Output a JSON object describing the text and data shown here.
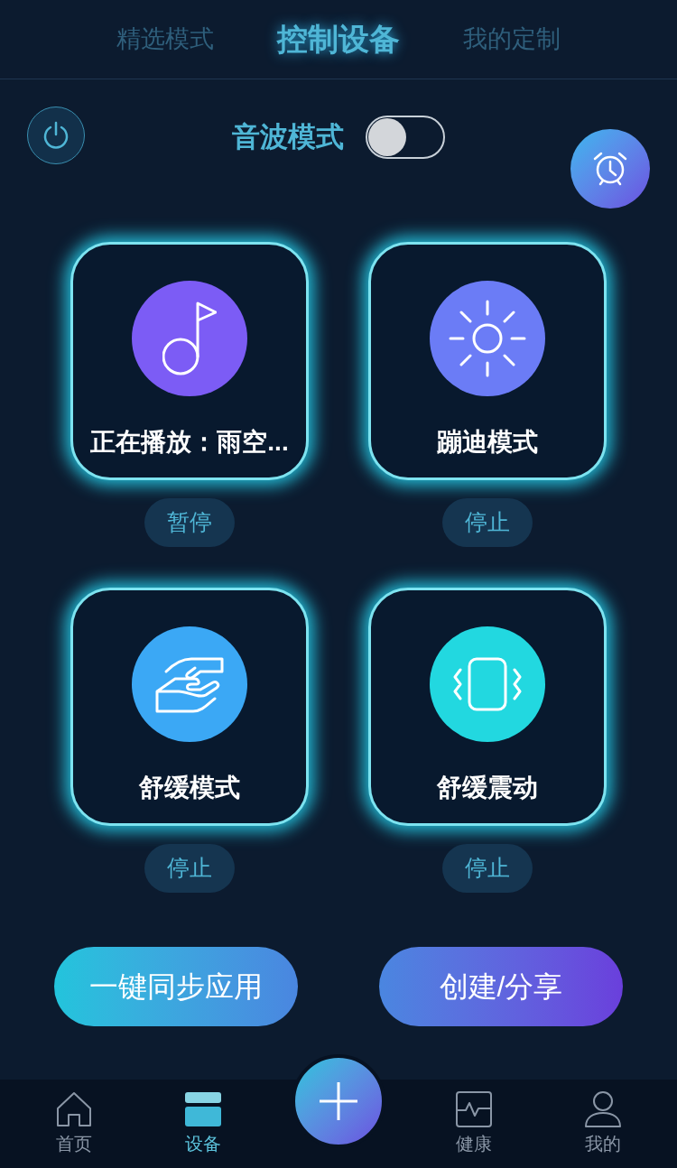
{
  "tabs": [
    {
      "label": "精选模式",
      "selected": false
    },
    {
      "label": "控制设备",
      "selected": true
    },
    {
      "label": "我的定制",
      "selected": false
    }
  ],
  "sound_mode": {
    "label": "音波模式",
    "on": false
  },
  "modes": [
    {
      "kind": "music",
      "title": "正在播放：雨空...",
      "color": "#7c5cf5",
      "button": "暂停"
    },
    {
      "kind": "sun",
      "title": "蹦迪模式",
      "color": "#6b7cf6",
      "button": "停止"
    },
    {
      "kind": "hands",
      "title": "舒缓模式",
      "color": "#3ba8f5",
      "button": "停止"
    },
    {
      "kind": "vibrate",
      "title": "舒缓震动",
      "color": "#22d8e0",
      "button": "停止"
    }
  ],
  "actions": [
    {
      "kind": "sync",
      "label": "一键同步应用"
    },
    {
      "kind": "share",
      "label": "创建/分享"
    }
  ],
  "nav": [
    {
      "kind": "home",
      "label": "首页",
      "selected": false
    },
    {
      "kind": "device",
      "label": "设备",
      "selected": true
    },
    {
      "kind": "add"
    },
    {
      "kind": "health",
      "label": "健康",
      "selected": false
    },
    {
      "kind": "me",
      "label": "我的",
      "selected": false
    }
  ]
}
